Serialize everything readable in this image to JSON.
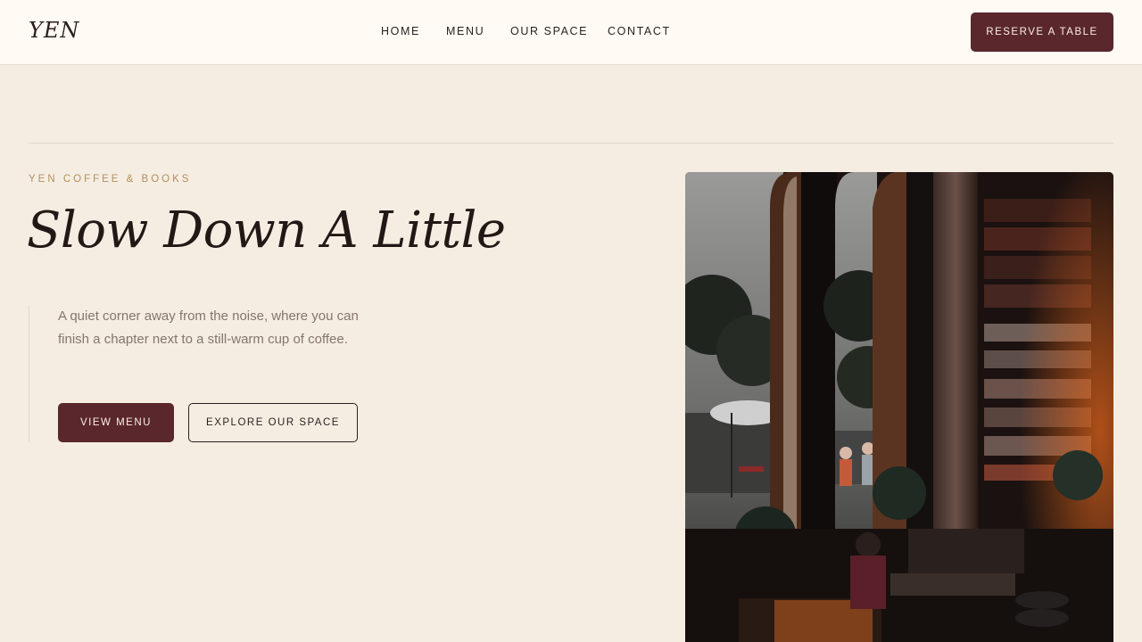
{
  "header": {
    "logo": "YEN",
    "nav": [
      "HOME",
      "MENU",
      "OUR SPACE",
      "CONTACT"
    ],
    "reserve_label": "RESERVE A TABLE"
  },
  "hero": {
    "eyebrow": "YEN COFFEE & BOOKS",
    "title": "Slow Down A Little",
    "description": "A quiet corner away from the noise, where you can finish a chapter next to a still-warm cup of coffee.",
    "primary_button": "VIEW MENU",
    "secondary_button": "EXPLORE OUR SPACE"
  },
  "colors": {
    "background": "#f5ede2",
    "header_bg": "#fffaf3",
    "accent": "#5a272c",
    "eyebrow": "#b48f5e",
    "text": "#2a1f1d",
    "muted_text": "#85766c"
  }
}
